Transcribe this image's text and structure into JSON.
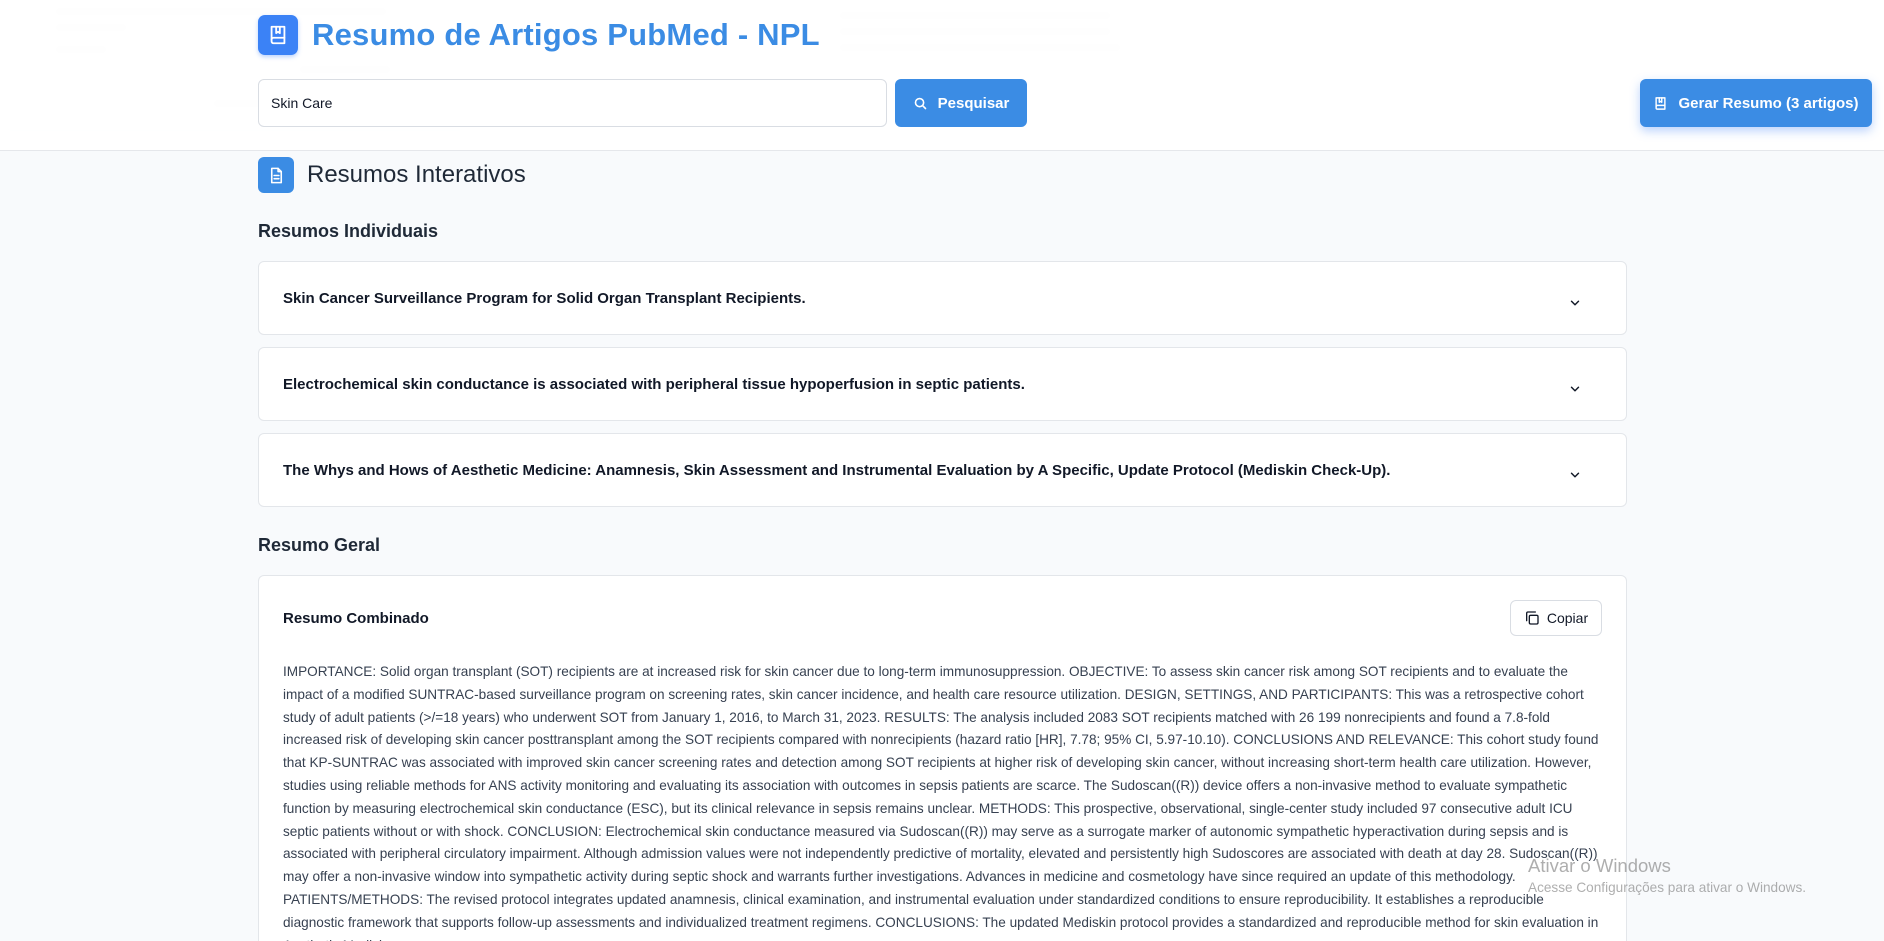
{
  "app": {
    "title": "Resumo de Artigos PubMed - NPL",
    "icon": "book-icon",
    "accent_color": "#3b8ce4"
  },
  "search": {
    "value": "Skin Care",
    "button_label": "Pesquisar",
    "button_icon": "search-icon"
  },
  "generate": {
    "label": "Gerar Resumo (3 artigos)",
    "icon": "book-icon"
  },
  "section": {
    "title": "Resumos Interativos",
    "icon": "document-icon"
  },
  "individual": {
    "heading": "Resumos Individuais",
    "items": [
      {
        "title": "Skin Cancer Surveillance Program for Solid Organ Transplant Recipients."
      },
      {
        "title": "Electrochemical skin conductance is associated with peripheral tissue hypoperfusion in septic patients."
      },
      {
        "title": "The Whys and Hows of Aesthetic Medicine: Anamnesis, Skin Assessment and Instrumental Evaluation by A Specific, Update Protocol (Mediskin Check-Up)."
      }
    ]
  },
  "general": {
    "heading": "Resumo Geral",
    "card_title": "Resumo Combinado",
    "copy_label": "Copiar",
    "text": "IMPORTANCE: Solid organ transplant (SOT) recipients are at increased risk for  skin cancer due to long-term immunosuppression. OBJECTIVE: To assess skin cancer risk among SOT recipients and to evaluate the impact of a modified SUNTRAC-based surveillance program on screening rates, skin cancer incidence, and health care resource utilization. DESIGN, SETTINGS, AND PARTICIPANTS: This was a retrospective cohort study of adult patients (>/=18 years) who underwent SOT from January 1, 2016, to March 31, 2023. RESULTS: The analysis included 2083 SOT recipients matched with 26 199 nonrecipients and found a 7.8-fold increased risk of developing skin cancer posttransplant among the SOT recipients compared with nonrecipients (hazard ratio [HR], 7.78; 95% CI, 5.97-10.10). CONCLUSIONS AND RELEVANCE: This cohort study found that KP-SUNTRAC was associated with improved skin cancer screening rates and detection among SOT recipients at higher risk of developing skin cancer, without increasing short-term health care utilization. However, studies using reliable methods for ANS activity monitoring and evaluating its association with outcomes in sepsis patients are scarce. The Sudoscan((R)) device offers a non-invasive method to evaluate sympathetic function by measuring electrochemical skin conductance (ESC), but its clinical relevance in sepsis remains unclear. METHODS: This prospective, observational, single-center study included 97 consecutive adult ICU septic patients without or with shock. CONCLUSION: Electrochemical skin conductance measured via Sudoscan((R)) may serve as a surrogate marker of autonomic sympathetic hyperactivation during sepsis and is associated with peripheral circulatory impairment. Although admission values were not independently predictive of mortality, elevated and persistently high Sudoscores are associated with death at day 28. Sudoscan((R)) may offer a non-invasive window into sympathetic activity during septic shock and warrants further investigations. Advances in medicine and cosmetology have since required an update of this methodology. PATIENTS/METHODS: The revised protocol integrates updated anamnesis, clinical examination, and instrumental evaluation under standardized conditions to ensure reproducibility. It establishes a reproducible diagnostic framework that supports follow-up assessments and individualized treatment regimens. CONCLUSIONS: The updated Mediskin protocol provides a standardized and reproducible method for skin evaluation in Aesthetic Medicine."
  },
  "watermark": {
    "title": "Ativar o Windows",
    "subtitle": "Acesse Configurações para ativar o Windows."
  }
}
